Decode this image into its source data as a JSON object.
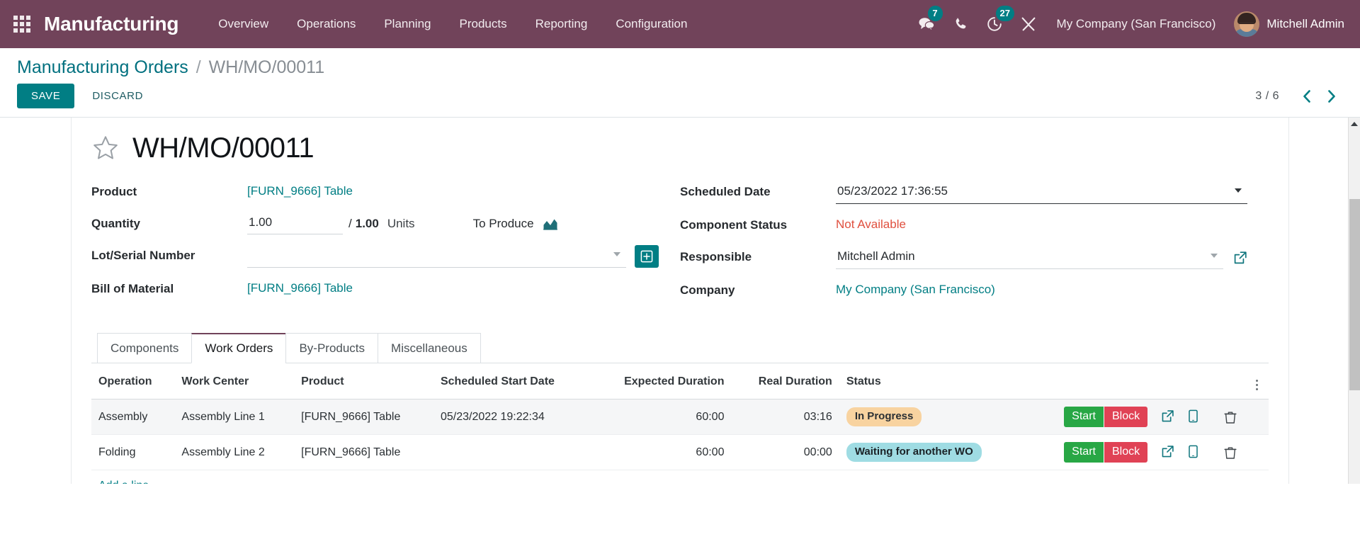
{
  "navbar": {
    "apps_icon": "apps-grid-icon",
    "brand": "Manufacturing",
    "menu": [
      {
        "label": "Overview"
      },
      {
        "label": "Operations"
      },
      {
        "label": "Planning"
      },
      {
        "label": "Products"
      },
      {
        "label": "Reporting"
      },
      {
        "label": "Configuration"
      }
    ],
    "systray": {
      "messages_icon": "chat-bubbles-icon",
      "messages_count": "7",
      "phone_icon": "phone-icon",
      "activities_icon": "clock-activity-icon",
      "activities_count": "27",
      "debug_icon": "wrench-tools-icon"
    },
    "company": "My Company (San Francisco)",
    "user": "Mitchell Admin",
    "background_color": "#71435a",
    "badge_color": "#017e84"
  },
  "control_panel": {
    "breadcrumb_root": "Manufacturing Orders",
    "breadcrumb_separator": "/",
    "breadcrumb_current": "WH/MO/00011",
    "save_label": "SAVE",
    "discard_label": "DISCARD",
    "pager_counter": "3 / 6",
    "pager_prev_icon": "chevron-left-icon",
    "pager_next_icon": "chevron-right-icon",
    "accent_color": "#017e84"
  },
  "form": {
    "favorite_icon": "star-outline-icon",
    "title": "WH/MO/00011",
    "left_fields": {
      "product_label": "Product",
      "product_value": "[FURN_9666] Table",
      "quantity_label": "Quantity",
      "quantity_value": "1.00",
      "quantity_separator": "/",
      "quantity_total": "1.00",
      "quantity_uom": "Units",
      "to_produce_label": "To Produce",
      "to_produce_icon": "forecast-chart-icon",
      "lot_label": "Lot/Serial Number",
      "lot_value": "",
      "lot_placeholder": "",
      "lot_add_icon": "plus-box-icon",
      "bom_label": "Bill of Material",
      "bom_value": "[FURN_9666] Table"
    },
    "right_fields": {
      "scheduled_label": "Scheduled Date",
      "scheduled_value": "05/23/2022 17:36:55",
      "component_status_label": "Component Status",
      "component_status_value": "Not Available",
      "component_status_color": "#e0503f",
      "responsible_label": "Responsible",
      "responsible_value": "Mitchell Admin",
      "responsible_open_icon": "external-link-icon",
      "company_label": "Company",
      "company_value": "My Company (San Francisco)"
    }
  },
  "notebook": {
    "tabs": [
      {
        "label": "Components",
        "active": false
      },
      {
        "label": "Work Orders",
        "active": true
      },
      {
        "label": "By-Products",
        "active": false
      },
      {
        "label": "Miscellaneous",
        "active": false
      }
    ],
    "active_tab_border_color": "#71435a"
  },
  "work_orders": {
    "columns": [
      "Operation",
      "Work Center",
      "Product",
      "Scheduled Start Date",
      "Expected Duration",
      "Real Duration",
      "Status"
    ],
    "optional_columns_icon": "vertical-dots-icon",
    "rows": [
      {
        "operation": "Assembly",
        "work_center": "Assembly Line 1",
        "product": "[FURN_9666] Table",
        "scheduled_start_date": "05/23/2022 19:22:34",
        "expected_duration": "60:00",
        "real_duration": "03:16",
        "status": "In Progress",
        "status_style": "progress",
        "start_label": "Start",
        "block_label": "Block",
        "open_icon": "external-link-icon",
        "tablet_icon": "tablet-device-icon",
        "delete_icon": "trash-icon",
        "highlight": true
      },
      {
        "operation": "Folding",
        "work_center": "Assembly Line 2",
        "product": "[FURN_9666] Table",
        "scheduled_start_date": "",
        "expected_duration": "60:00",
        "real_duration": "00:00",
        "status": "Waiting for another WO",
        "status_style": "waiting",
        "start_label": "Start",
        "block_label": "Block",
        "open_icon": "external-link-icon",
        "tablet_icon": "tablet-device-icon",
        "delete_icon": "trash-icon",
        "highlight": false
      }
    ],
    "add_line_label": "Add a line",
    "status_colors": {
      "in_progress_bg": "#f8d3a0",
      "waiting_bg": "#9fdce3",
      "start_bg": "#28a745",
      "block_bg": "#e04255"
    }
  },
  "scrollbar": {
    "up_icon": "scroll-up-arrow-icon",
    "down_icon": "scroll-down-arrow-icon"
  }
}
